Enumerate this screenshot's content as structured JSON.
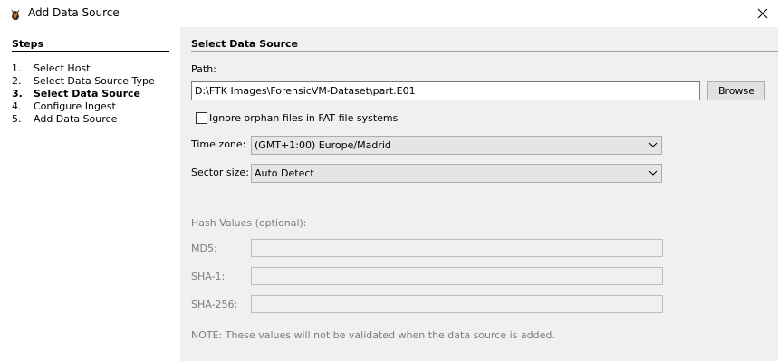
{
  "window": {
    "title": "Add Data Source",
    "app_icon": "autopsy-dog-icon",
    "close_icon": "close-icon"
  },
  "steps": {
    "title": "Steps",
    "items": [
      {
        "num": "1.",
        "label": "Select Host",
        "active": false
      },
      {
        "num": "2.",
        "label": "Select Data Source Type",
        "active": false
      },
      {
        "num": "3.",
        "label": "Select Data Source",
        "active": true
      },
      {
        "num": "4.",
        "label": "Configure Ingest",
        "active": false
      },
      {
        "num": "5.",
        "label": "Add Data Source",
        "active": false
      }
    ]
  },
  "main": {
    "section_title": "Select Data Source",
    "path_label": "Path:",
    "path_value": "D:\\FTK Images\\ForensicVM-Dataset\\part.E01",
    "browse_label": "Browse",
    "orphan_checkbox_label": "Ignore orphan files in FAT file systems",
    "orphan_checked": false,
    "timezone_label": "Time zone:",
    "timezone_value": "(GMT+1:00) Europe/Madrid",
    "sector_label": "Sector size:",
    "sector_value": "Auto Detect",
    "hash_title": "Hash Values (optional):",
    "md5_label": "MD5:",
    "sha1_label": "SHA-1:",
    "sha256_label": "SHA-256:",
    "note": "NOTE: These values will not be validated when the data source is added."
  }
}
